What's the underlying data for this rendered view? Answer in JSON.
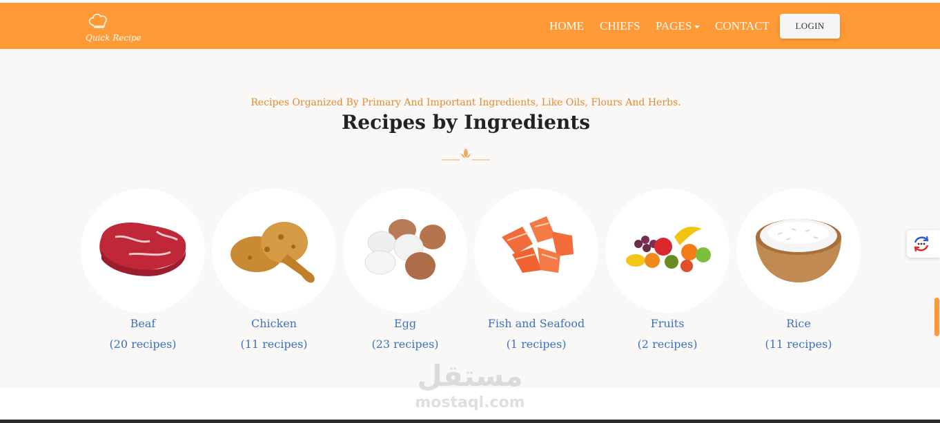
{
  "brand": {
    "name": "Quick Recipe",
    "primary_color": "#ff9a36",
    "link_color": "#3a72c4",
    "icon": "chef-hat-icon"
  },
  "nav": {
    "items": [
      "HOME",
      "CHIEFS",
      "PAGES",
      "CONTACT"
    ],
    "login_label": "LOGIN"
  },
  "section": {
    "subtitle": "Recipes Organized By Primary And Important Ingredients, Like Oils, Flours And Herbs.",
    "title": "Recipes by Ingredients",
    "divider_icon": "leaf-ornament-icon"
  },
  "categories": [
    {
      "name": "Beaf",
      "count": "(20 recipes)",
      "icon": "steak-icon"
    },
    {
      "name": "Chicken",
      "count": "(11 recipes)",
      "icon": "fried-chicken-icon"
    },
    {
      "name": "Egg",
      "count": "(23 recipes)",
      "icon": "eggs-icon"
    },
    {
      "name": "Fish and Seafood",
      "count": "(1 recipes)",
      "icon": "salmon-icon"
    },
    {
      "name": "Fruits",
      "count": "(2 recipes)",
      "icon": "fruits-icon"
    },
    {
      "name": "Rice",
      "count": "(11 recipes)",
      "icon": "rice-bowl-icon"
    }
  ],
  "watermark": {
    "arabic": "مستقل",
    "latin": "mostaql.com"
  },
  "side_widget": {
    "icon": "chat-refresh-icon"
  }
}
